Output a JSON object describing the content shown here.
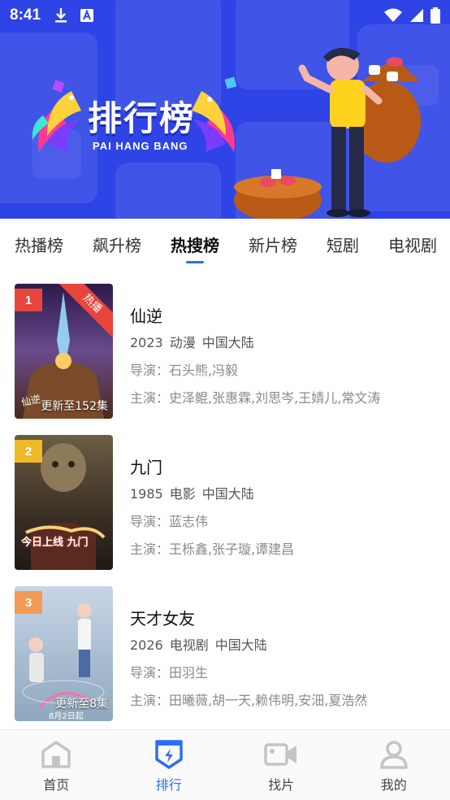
{
  "status_bar": {
    "time": "8:41"
  },
  "banner": {
    "title": "排行榜",
    "subtitle": "PAI HANG BANG"
  },
  "tabs": [
    {
      "label": "热播榜",
      "active": false
    },
    {
      "label": "飙升榜",
      "active": false
    },
    {
      "label": "热搜榜",
      "active": true
    },
    {
      "label": "新片榜",
      "active": false
    },
    {
      "label": "短剧",
      "active": false
    },
    {
      "label": "电视剧",
      "active": false
    }
  ],
  "items": [
    {
      "rank": "1",
      "rank_color": "#e8453c",
      "ribbon": "热播",
      "title": "仙逆",
      "year": "2023",
      "genre": "动漫",
      "region": "中国大陆",
      "director": "导演：石头熊,冯毅",
      "cast": "主演：史泽鲲,张惠霖,刘思岑,王婧儿,常文涛",
      "update": "更新至152集",
      "poster_label": "仙逆"
    },
    {
      "rank": "2",
      "rank_color": "#f0b928",
      "ribbon": "",
      "title": "九门",
      "year": "1985",
      "genre": "电影",
      "region": "中国大陆",
      "director": "导演：蓝志伟",
      "cast": "主演：王栎鑫,张子璇,谭建昌",
      "update": "",
      "poster_label": "今日上线 九门"
    },
    {
      "rank": "3",
      "rank_color": "#f39a55",
      "ribbon": "",
      "title": "天才女友",
      "year": "2026",
      "genre": "电视剧",
      "region": "中国大陆",
      "director": "导演：田羽生",
      "cast": "主演：田曦薇,胡一天,赖伟明,安沺,夏浩然",
      "update": "更新至8集",
      "poster_label": "8月2日起"
    }
  ],
  "bottom_nav": [
    {
      "label": "首页",
      "icon": "home-icon",
      "active": false
    },
    {
      "label": "排行",
      "icon": "rank-icon",
      "active": true
    },
    {
      "label": "找片",
      "icon": "video-camera-icon",
      "active": false
    },
    {
      "label": "我的",
      "icon": "person-icon",
      "active": false
    }
  ],
  "colors": {
    "banner_bg": "#2f44e6",
    "accent": "#2f6cf6",
    "hot_ribbon": "#e8453c"
  }
}
